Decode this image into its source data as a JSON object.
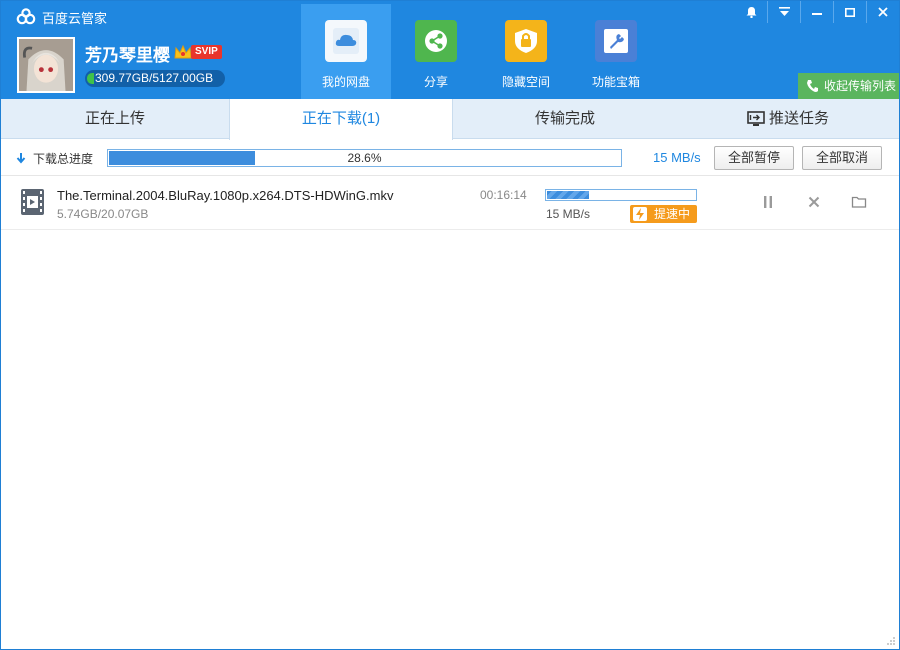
{
  "app": {
    "title": "百度云管家",
    "logo_icon": "cloud-logo-icon"
  },
  "user": {
    "name": "芳乃琴里樱",
    "badge": "SVIP",
    "quota": "309.77GB/5127.00GB"
  },
  "nav": [
    {
      "label": "我的网盘",
      "icon": "cloud-drive-icon",
      "active": true
    },
    {
      "label": "分享",
      "icon": "share-icon",
      "active": false
    },
    {
      "label": "隐藏空间",
      "icon": "lock-icon",
      "active": false
    },
    {
      "label": "功能宝箱",
      "icon": "toolbox-icon",
      "active": false
    }
  ],
  "window_controls": [
    "bell-icon",
    "menu-icon",
    "minimize-icon",
    "maximize-icon",
    "close-icon"
  ],
  "collapse_button": "收起传输列表",
  "tabs": [
    {
      "label": "正在上传"
    },
    {
      "label": "正在下载(1)",
      "active": true
    },
    {
      "label": "传输完成"
    },
    {
      "label": "推送任务",
      "icon": "push-screen-icon"
    }
  ],
  "summary": {
    "label": "下载总进度",
    "progress_percent": 28.6,
    "progress_text": "28.6%",
    "speed": "15 MB/s",
    "pause_all": "全部暂停",
    "cancel_all": "全部取消"
  },
  "tasks": [
    {
      "filename": "The.Terminal.2004.BluRay.1080p.x264.DTS-HDWinG.mkv",
      "size": "5.74GB/20.07GB",
      "time_left": "00:16:14",
      "progress_percent": 28.6,
      "speed": "15 MB/s",
      "boost": "提速中"
    }
  ],
  "colors": {
    "header_blue": "#1f87e0",
    "progress_blue": "#3d8ddd",
    "boost_orange": "#f59b1c",
    "collapse_green": "#5ab55e"
  }
}
